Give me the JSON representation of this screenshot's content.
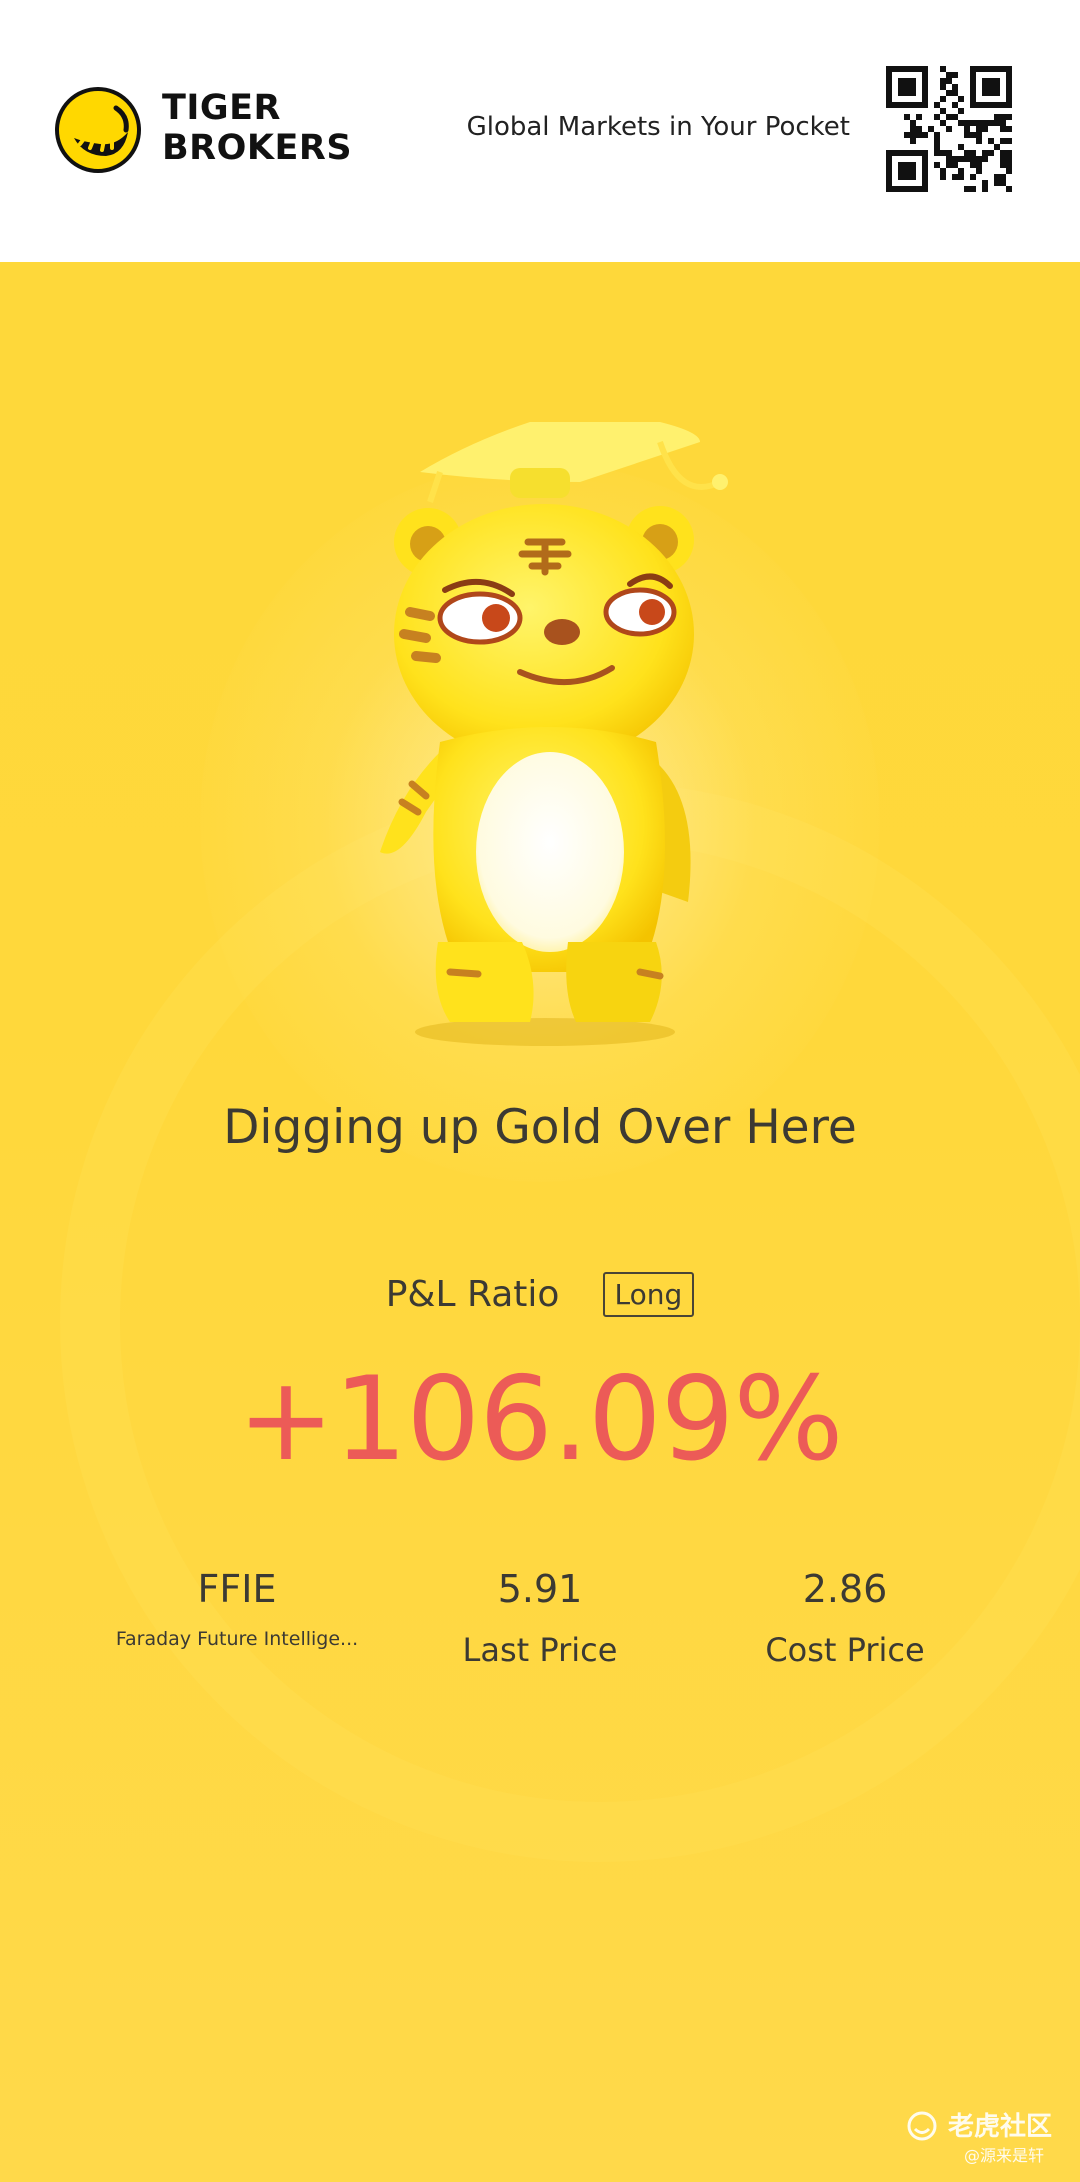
{
  "header": {
    "brand_line1": "TIGER",
    "brand_line2": "BROKERS",
    "tagline": "Global Markets in Your Pocket",
    "logo_icon": "tiger-paw-logo-icon",
    "qr_icon": "qr-code-icon"
  },
  "poster": {
    "illustration": "tiger-mascot-illustration",
    "headline": "Digging up Gold Over Here",
    "pl_label": "P&L Ratio",
    "position_badge": "Long",
    "pl_value": "+106.09%",
    "stats": {
      "symbol": "FFIE",
      "company": "Faraday Future Intellige...",
      "last_price": "5.91",
      "last_price_label": "Last Price",
      "cost_price": "2.86",
      "cost_price_label": "Cost Price"
    }
  },
  "watermark": {
    "title": "老虎社区",
    "handle": "@源来是轩"
  },
  "colors": {
    "background": "#fed83a",
    "gain": "#ec5b57",
    "text": "#3c3a33",
    "header_bg": "#ffffff"
  }
}
